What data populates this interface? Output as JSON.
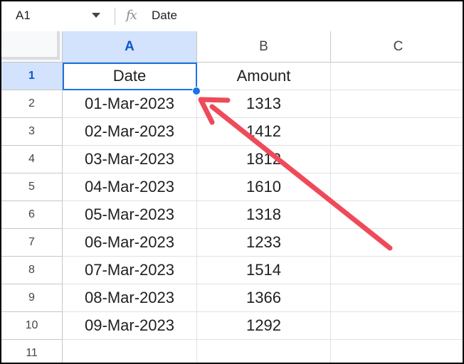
{
  "name_box": {
    "value": "A1"
  },
  "formula_bar": {
    "fx_label": "fx",
    "content": "Date"
  },
  "columns": [
    "A",
    "B",
    "C"
  ],
  "selected_column": "A",
  "selected_row": "1",
  "rows": [
    {
      "num": "1",
      "a": "Date",
      "b": "Amount"
    },
    {
      "num": "2",
      "a": "01-Mar-2023",
      "b": "1313"
    },
    {
      "num": "3",
      "a": "02-Mar-2023",
      "b": "1412"
    },
    {
      "num": "4",
      "a": "03-Mar-2023",
      "b": "1812"
    },
    {
      "num": "5",
      "a": "04-Mar-2023",
      "b": "1610"
    },
    {
      "num": "6",
      "a": "05-Mar-2023",
      "b": "1318"
    },
    {
      "num": "7",
      "a": "06-Mar-2023",
      "b": "1233"
    },
    {
      "num": "8",
      "a": "07-Mar-2023",
      "b": "1514"
    },
    {
      "num": "9",
      "a": "08-Mar-2023",
      "b": "1366"
    },
    {
      "num": "10",
      "a": "09-Mar-2023",
      "b": "1292"
    },
    {
      "num": "11",
      "a": "",
      "b": ""
    }
  ],
  "colors": {
    "selection": "#1a73e8",
    "header_selected_bg": "#d3e3fd",
    "annotation_arrow": "#ef4a5a"
  },
  "annotation": {
    "type": "arrow",
    "points_to": "fill-handle"
  }
}
